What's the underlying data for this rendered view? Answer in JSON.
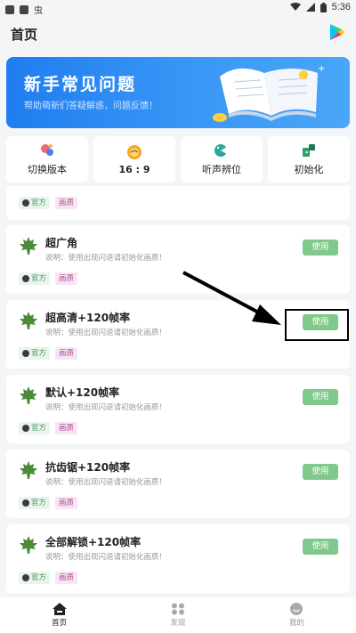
{
  "status_bar": {
    "time": "5:36",
    "bug_icon": "虫"
  },
  "header": {
    "title": "首页"
  },
  "banner": {
    "title": "新手常见问题",
    "subtitle": "帮助萌新们答疑解惑，问题反馈！"
  },
  "quick_actions": [
    {
      "label": "切换版本",
      "icon": "toggle-icon"
    },
    {
      "label": "16 : 9",
      "icon": "aspect-ratio-icon"
    },
    {
      "label": "听声辨位",
      "icon": "audio-icon"
    },
    {
      "label": "初始化",
      "icon": "reset-icon"
    }
  ],
  "partial_card": {
    "tag_official": "官方",
    "tag_quality": "画质"
  },
  "cards": [
    {
      "title": "超广角",
      "desc": "说明：使用出现闪退请初始化画质！",
      "tag_official": "官方",
      "tag_quality": "画质",
      "button": "使用"
    },
    {
      "title": "超高清+120帧率",
      "desc": "说明：使用出现闪退请初始化画质！",
      "tag_official": "官方",
      "tag_quality": "画质",
      "button": "使用"
    },
    {
      "title": "默认+120帧率",
      "desc": "说明：使用出现闪退请初始化画质！",
      "tag_official": "官方",
      "tag_quality": "画质",
      "button": "使用"
    },
    {
      "title": "抗齿锯+120帧率",
      "desc": "说明：使用出现闪退请初始化画质！",
      "tag_official": "官方",
      "tag_quality": "画质",
      "button": "使用"
    },
    {
      "title": "全部解锁+120帧率",
      "desc": "说明：使用出现闪退请初始化画质！",
      "tag_official": "官方",
      "tag_quality": "画质",
      "button": "使用"
    }
  ],
  "bottom_nav": [
    {
      "label": "首页",
      "icon": "home-icon",
      "active": true
    },
    {
      "label": "发现",
      "icon": "discover-icon",
      "active": false
    },
    {
      "label": "我的",
      "icon": "profile-icon",
      "active": false
    }
  ],
  "colors": {
    "accent_green": "#7fca8a",
    "banner_blue": "#1f7df0"
  }
}
